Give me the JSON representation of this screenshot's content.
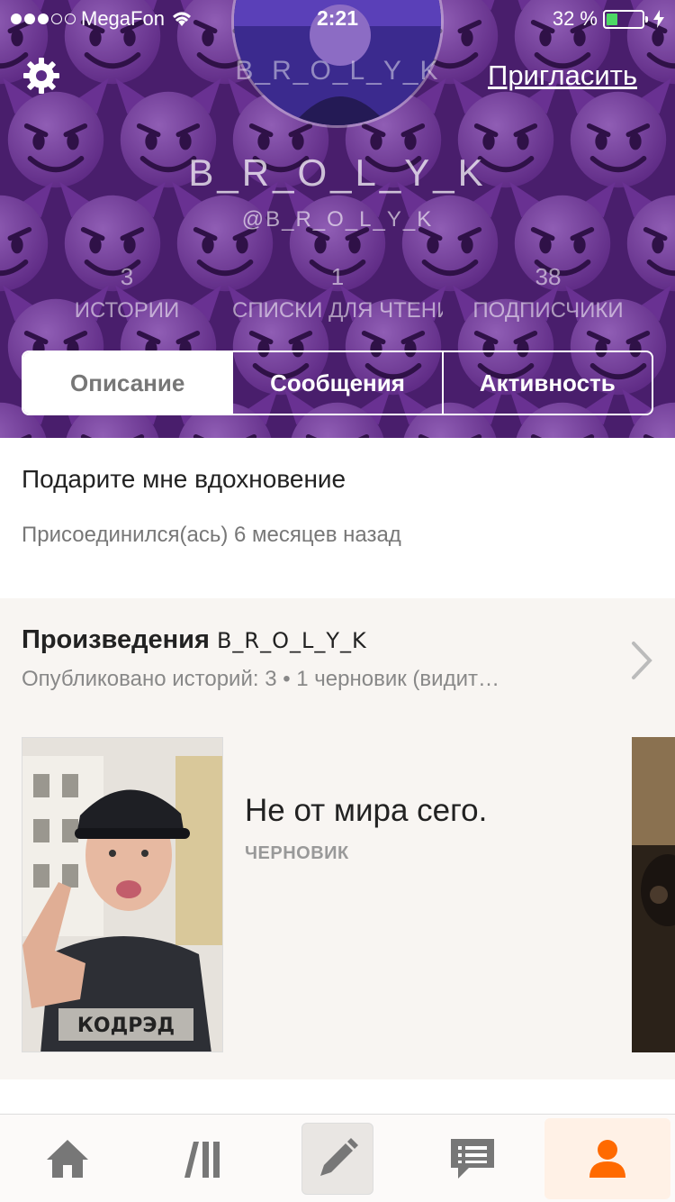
{
  "status_bar": {
    "carrier": "MegaFon",
    "time": "2:21",
    "battery_percent": "32 %",
    "battery_level": 0.32,
    "signal_bars": 2
  },
  "header": {
    "avatar_name": "B_R_O_L_Y_K",
    "invite_label": "Пригласить",
    "display_name": "B_R_O_L_Y_K",
    "username": "@B_R_O_L_Y_K",
    "stats": [
      {
        "value": "3",
        "label": "ИСТОРИИ"
      },
      {
        "value": "1",
        "label": "СПИСКИ ДЛЯ ЧТЕНИ"
      },
      {
        "value": "38",
        "label": "ПОДПИСЧИКИ"
      }
    ],
    "tabs": [
      {
        "label": "Описание",
        "active": true
      },
      {
        "label": "Сообщения",
        "active": false
      },
      {
        "label": "Активность",
        "active": false
      }
    ],
    "background_color": "#5b2b86"
  },
  "about": {
    "quote": "Подарите мне вдохновение",
    "joined": "Присоединился(ась) 6 месяцев назад"
  },
  "works": {
    "title_prefix": "Произведения",
    "title_name": "B_R_O_L_Y_K",
    "subtitle": "Опубликовано историй: 3 • 1 черновик (видит…",
    "story": {
      "title": "Не от мира сего.",
      "status": "ЧЕРНОВИК",
      "cover_text": "КОДРЭД"
    }
  },
  "tabbar": {
    "items": [
      "home-icon",
      "library-icon",
      "pencil-icon",
      "messages-icon",
      "person-icon"
    ],
    "active": "person-icon",
    "accent": "#ff6a00",
    "icon_color": "#777777"
  }
}
